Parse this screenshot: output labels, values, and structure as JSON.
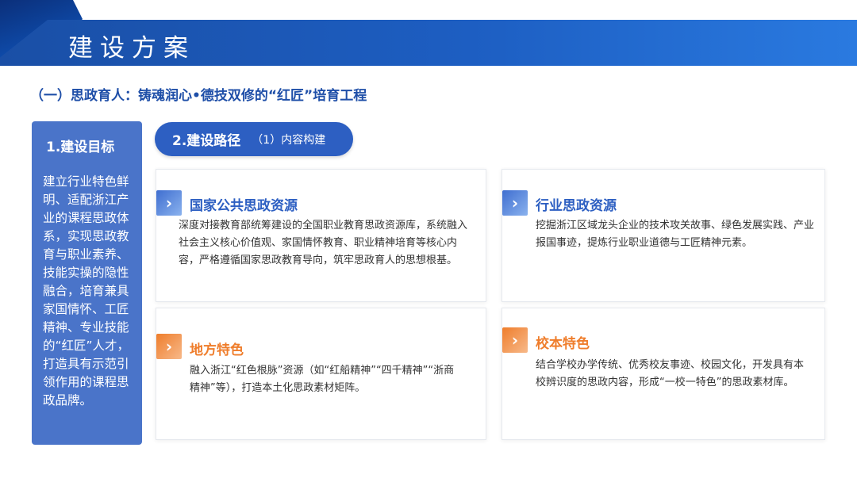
{
  "header": {
    "title": "建设方案"
  },
  "section": {
    "subtitle": "（一）思政育人：铸魂润心•德技双修的“红匠”培育工程"
  },
  "goal": {
    "title": "1.建设目标",
    "text": "建立行业特色鲜明、适配浙江产业的课程思政体系，实现思政教育与职业素养、技能实操的隐性融合，培育兼具家国情怀、工匠精神、专业技能的“红匠”人才，打造具有示范引领作用的课程思政品牌。"
  },
  "path": {
    "label": "2.建设路径",
    "sub": "（1）内容构建"
  },
  "cards": [
    {
      "title": "国家公共思政资源",
      "body": "深度对接教育部统筹建设的全国职业教育思政资源库，系统融入社会主义核心价值观、家国情怀教育、职业精神培育等核心内容，严格遵循国家思政教育导向，筑牢思政育人的思想根基。"
    },
    {
      "title": "行业思政资源",
      "body": "挖掘浙江区域龙头企业的技术攻关故事、绿色发展实践、产业报国事迹，提炼行业职业道德与工匠精神元素。"
    },
    {
      "title": "地方特色",
      "body": "融入浙江“红色根脉”资源（如“红船精神”“四千精神”“浙商精神”等），打造本土化思政素材矩阵。"
    },
    {
      "title": "校本特色",
      "body": "结合学校办学传统、优秀校友事迹、校园文化，开发具有本校辨识度的思政内容，形成“一校一特色”的思政素材库。"
    }
  ],
  "icons": {
    "card_icon": "chevron-right-icon"
  },
  "colors": {
    "primary_blue": "#2d5fc2",
    "accent_orange": "#ef7d2b",
    "panel_blue": "#4a74c9"
  }
}
